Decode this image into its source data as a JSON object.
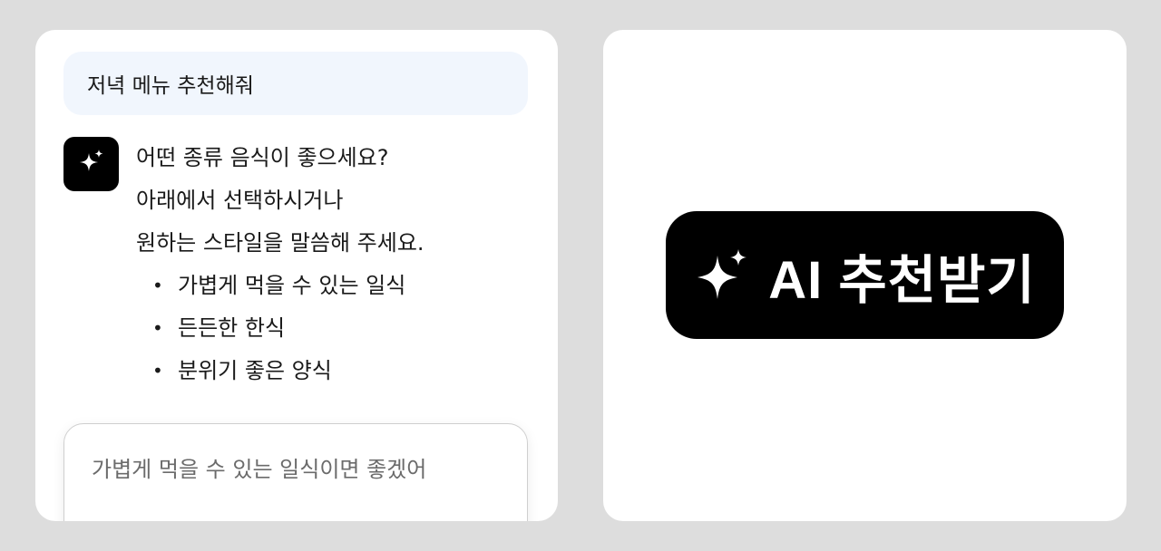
{
  "chat": {
    "user_message": "저녁 메뉴 추천해줘",
    "ai_lines": [
      "어떤 종류 음식이 좋으세요?",
      "아래에서 선택하시거나",
      "원하는 스타일을 말씀해 주세요."
    ],
    "options": [
      "가볍게 먹을 수 있는 일식",
      "든든한 한식",
      "분위기 좋은 양식"
    ],
    "bullet": "•",
    "input_value": "가볍게 먹을 수 있는 일식이면 좋겠어",
    "avatar_icon": "sparkle-icon"
  },
  "cta": {
    "label": "AI 추천받기",
    "icon": "sparkle-icon"
  },
  "colors": {
    "background": "#dddddd",
    "panel": "#ffffff",
    "user_bubble": "#f1f6fd",
    "accent": "#000000"
  }
}
